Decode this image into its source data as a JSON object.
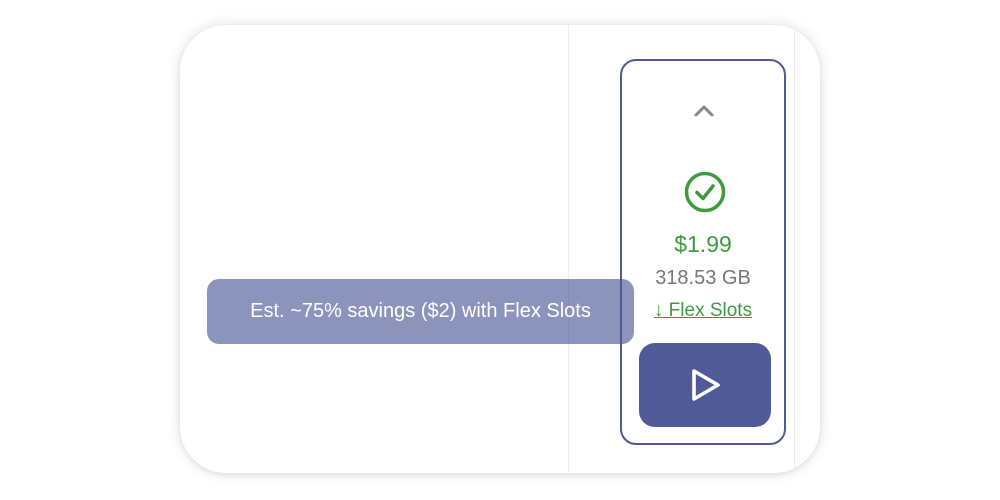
{
  "cost_panel": {
    "price": "$1.99",
    "data_size": "318.53 GB",
    "flex_slots_link": "↓ Flex Slots",
    "collapse_icon": "chevron-up-icon",
    "status_icon": "check-circle-icon",
    "run_icon": "play-icon"
  },
  "tooltip": {
    "text": "Est. ~75% savings ($2) with Flex Slots"
  },
  "colors": {
    "accent": "#4f5a96",
    "success": "#3f9a3f",
    "muted_text": "#777777"
  }
}
